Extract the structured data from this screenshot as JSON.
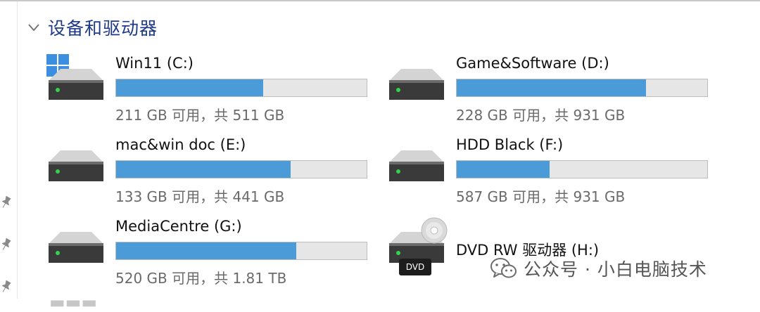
{
  "section": {
    "title": "设备和驱动器"
  },
  "drives": [
    {
      "name": "Win11 (C:)",
      "space": "211 GB 可用，共 511 GB",
      "used_fraction": 0.587,
      "icon": "windows-system-drive-icon"
    },
    {
      "name": "Game&Software (D:)",
      "space": "228 GB 可用，共 931 GB",
      "used_fraction": 0.755,
      "icon": "hard-drive-icon"
    },
    {
      "name": "mac&win doc (E:)",
      "space": "133 GB 可用，共 441 GB",
      "used_fraction": 0.698,
      "icon": "hard-drive-icon"
    },
    {
      "name": "HDD Black (F:)",
      "space": "587 GB 可用，共 931 GB",
      "used_fraction": 0.37,
      "icon": "hard-drive-icon"
    },
    {
      "name": "MediaCentre (G:)",
      "space": "520 GB 可用，共 1.81 TB",
      "used_fraction": 0.719,
      "icon": "hard-drive-icon"
    },
    {
      "name": "DVD RW 驱动器 (H:)",
      "icon": "dvd-drive-icon",
      "badge": "DVD"
    }
  ],
  "watermark": {
    "text": "公众号 · 小白电脑技术",
    "icon": "wechat-icon"
  },
  "colors": {
    "accent": "#4a9bd8",
    "section_title": "#1e3a87",
    "bar_track": "#e6e6e6"
  }
}
